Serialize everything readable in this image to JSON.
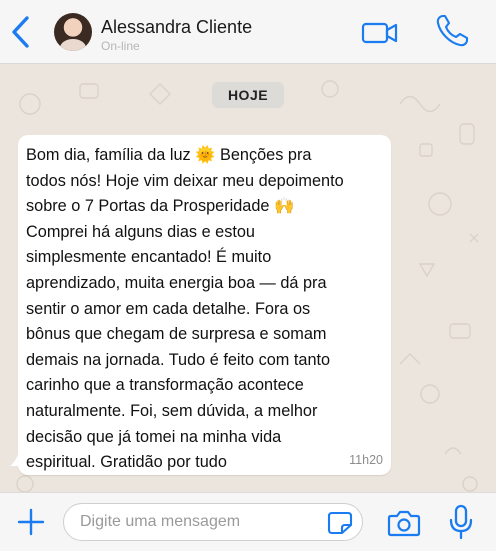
{
  "header": {
    "contact_name": "Alessandra Cliente",
    "status": "On-line",
    "accent_color": "#1a7cf0"
  },
  "chat": {
    "date_label": "HOJE",
    "messages": [
      {
        "lines": [
          "Bom dia, família da luz 🌞 Benções pra",
          "todos nós! Hoje vim deixar meu depoimento",
          "sobre o 7 Portas da Prosperidade 🙌",
          "Comprei há alguns dias e estou",
          "simplesmente encantado! É muito",
          "aprendizado, muita energia boa — dá pra",
          "sentir o amor em cada detalhe. Fora os",
          "bônus que chegam de surpresa e somam",
          "demais na jornada. Tudo é feito com tanto",
          "carinho que a transformação acontece",
          "naturalmente. Foi, sem dúvida, a melhor",
          "decisão que já tomei na minha vida",
          "espiritual. Gratidão por tudo"
        ],
        "time": "11h20"
      }
    ]
  },
  "composer": {
    "placeholder": "Digite uma mensagem",
    "value": ""
  },
  "icons": {
    "back": "chevron-left-icon",
    "video": "video-camera-icon",
    "phone": "phone-icon",
    "plus": "plus-icon",
    "sticker": "sticker-icon",
    "camera": "camera-icon",
    "mic": "microphone-icon"
  }
}
